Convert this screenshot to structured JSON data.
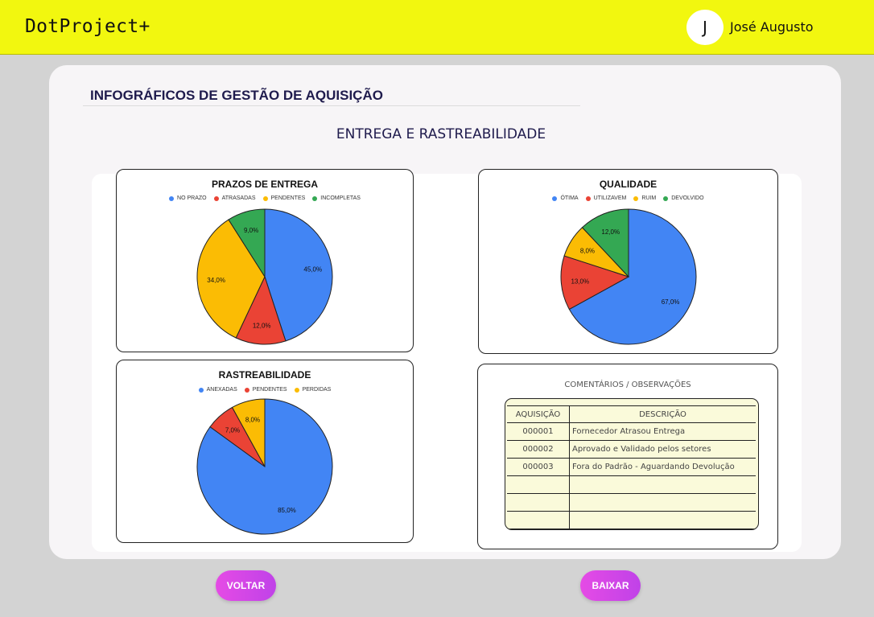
{
  "header": {
    "app_title": "DotProject+",
    "avatar_initial": "J",
    "user_name": "José Augusto"
  },
  "page": {
    "title": "INFOGRÁFICOS DE GESTÃO DE AQUISIÇÃO",
    "section_title": "ENTREGA E RASTREABILIDADE"
  },
  "chart_data": [
    {
      "type": "pie",
      "title": "PRAZOS DE ENTREGA",
      "labels": [
        "NO PRAZO",
        "ATRASADAS",
        "PENDENTES",
        "INCOMPLETAS"
      ],
      "values": [
        45.0,
        12.0,
        34.0,
        9.0
      ],
      "value_labels": [
        "45,0%",
        "12,0%",
        "34,0%",
        "9,0%"
      ],
      "colors": [
        "#4285f4",
        "#ea4335",
        "#fbbc04",
        "#34a853"
      ],
      "legend": "top"
    },
    {
      "type": "pie",
      "title": "QUALIDADE",
      "labels": [
        "ÓTIMA",
        "UTILIZAVEM",
        "RUIM",
        "DEVOLVIDO"
      ],
      "values": [
        67.0,
        13.0,
        8.0,
        12.0
      ],
      "value_labels": [
        "67,0%",
        "13,0%",
        "8,0%",
        "12,0%"
      ],
      "colors": [
        "#4285f4",
        "#ea4335",
        "#fbbc04",
        "#34a853"
      ],
      "legend": "top"
    },
    {
      "type": "pie",
      "title": "RASTREABILIDADE",
      "labels": [
        "ANEXADAS",
        "PENDENTES",
        "PERDIDAS"
      ],
      "values": [
        85.0,
        7.0,
        8.0
      ],
      "value_labels": [
        "85,0%",
        "7,0%",
        "8,0%"
      ],
      "colors": [
        "#4285f4",
        "#ea4335",
        "#fbbc04"
      ],
      "legend": "top"
    }
  ],
  "comments": {
    "title": "COMENTÁRIOS / OBSERVAÇÕES",
    "headers": [
      "AQUISIÇÃO",
      "DESCRIÇÃO"
    ],
    "rows": [
      {
        "id": "000001",
        "desc": "Fornecedor Atrasou Entrega"
      },
      {
        "id": "000002",
        "desc": "Aprovado e Validado pelos setores"
      },
      {
        "id": "000003",
        "desc": "Fora do Padrão - Aguardando Devolução"
      },
      {
        "id": "",
        "desc": ""
      },
      {
        "id": "",
        "desc": ""
      },
      {
        "id": "",
        "desc": ""
      }
    ]
  },
  "buttons": {
    "back_label": "VOLTAR",
    "download_label": "BAIXAR"
  }
}
